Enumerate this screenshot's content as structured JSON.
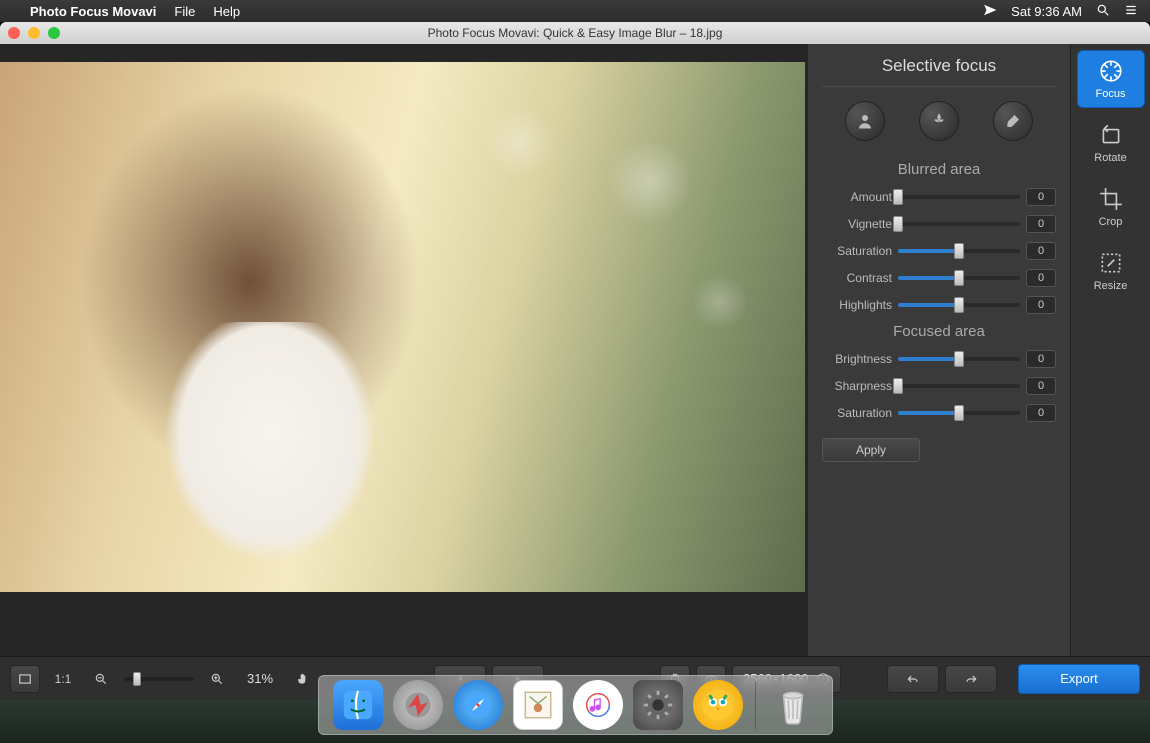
{
  "menubar": {
    "app": "Photo Focus Movavi",
    "items": [
      "File",
      "Help"
    ],
    "clock": "Sat 9:36 AM"
  },
  "window": {
    "title": "Photo Focus Movavi: Quick & Easy Image Blur – 18.jpg"
  },
  "panel": {
    "title": "Selective focus",
    "modes": [
      "portrait",
      "macro",
      "brush"
    ],
    "blurred_head": "Blurred area",
    "focused_head": "Focused area",
    "sliders_blur": [
      {
        "label": "Amount",
        "value": "0",
        "fill": 0
      },
      {
        "label": "Vignette",
        "value": "0",
        "fill": 0
      },
      {
        "label": "Saturation",
        "value": "0",
        "fill": 50
      },
      {
        "label": "Contrast",
        "value": "0",
        "fill": 50
      },
      {
        "label": "Highlights",
        "value": "0",
        "fill": 50
      }
    ],
    "sliders_focus": [
      {
        "label": "Brightness",
        "value": "0",
        "fill": 50
      },
      {
        "label": "Sharpness",
        "value": "0",
        "fill": 0
      },
      {
        "label": "Saturation",
        "value": "0",
        "fill": 50
      }
    ],
    "apply": "Apply"
  },
  "tools": [
    {
      "id": "focus",
      "label": "Focus",
      "active": true
    },
    {
      "id": "rotate",
      "label": "Rotate",
      "active": false
    },
    {
      "id": "crop",
      "label": "Crop",
      "active": false
    },
    {
      "id": "resize",
      "label": "Resize",
      "active": false
    }
  ],
  "bottombar": {
    "fit_label": "1:1",
    "zoom_pct": "31%",
    "dimensions": "2560×1600",
    "export": "Export"
  },
  "dock": [
    "finder",
    "launchpad",
    "safari",
    "mail",
    "music",
    "settings",
    "owl",
    "trash"
  ]
}
